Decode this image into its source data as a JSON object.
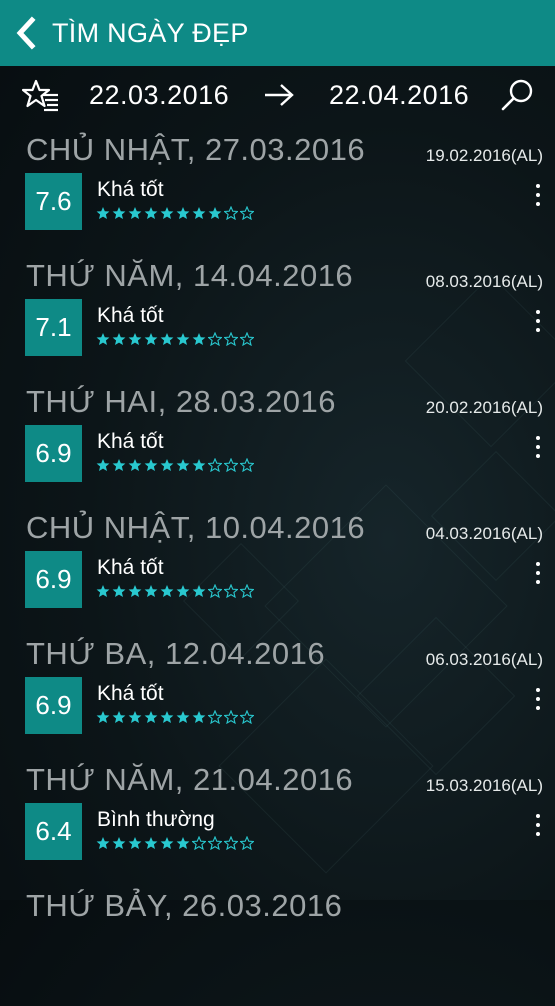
{
  "header": {
    "title": "TÌM NGÀY ĐẸP"
  },
  "toolbar": {
    "from_date": "22.03.2016",
    "to_date": "22.04.2016",
    "icons": {
      "favorites": "star-list-icon",
      "arrow": "arrow-right-icon",
      "search": "search-icon"
    }
  },
  "colors": {
    "accent": "#0e8a86",
    "star": "#29c8cf",
    "day_title": "#9ea4a6"
  },
  "days": [
    {
      "title": "CHỦ NHẬT, 27.03.2016",
      "lunar": "19.02.2016(AL)",
      "score": "7.6",
      "label": "Khá tốt",
      "rating": 8,
      "max_rating": 10
    },
    {
      "title": "THỨ NĂM, 14.04.2016",
      "lunar": "08.03.2016(AL)",
      "score": "7.1",
      "label": "Khá tốt",
      "rating": 7,
      "max_rating": 10
    },
    {
      "title": "THỨ HAI, 28.03.2016",
      "lunar": "20.02.2016(AL)",
      "score": "6.9",
      "label": "Khá tốt",
      "rating": 7,
      "max_rating": 10
    },
    {
      "title": "CHỦ NHẬT, 10.04.2016",
      "lunar": "04.03.2016(AL)",
      "score": "6.9",
      "label": "Khá tốt",
      "rating": 7,
      "max_rating": 10
    },
    {
      "title": "THỨ BA, 12.04.2016",
      "lunar": "06.03.2016(AL)",
      "score": "6.9",
      "label": "Khá tốt",
      "rating": 7,
      "max_rating": 10
    },
    {
      "title": "THỨ NĂM, 21.04.2016",
      "lunar": "15.03.2016(AL)",
      "score": "6.4",
      "label": "Bình thường",
      "rating": 6,
      "max_rating": 10
    },
    {
      "title": "THỨ BẢY, 26.03.2016",
      "lunar": "",
      "score": "",
      "label": "",
      "rating": 0,
      "max_rating": 10
    }
  ]
}
